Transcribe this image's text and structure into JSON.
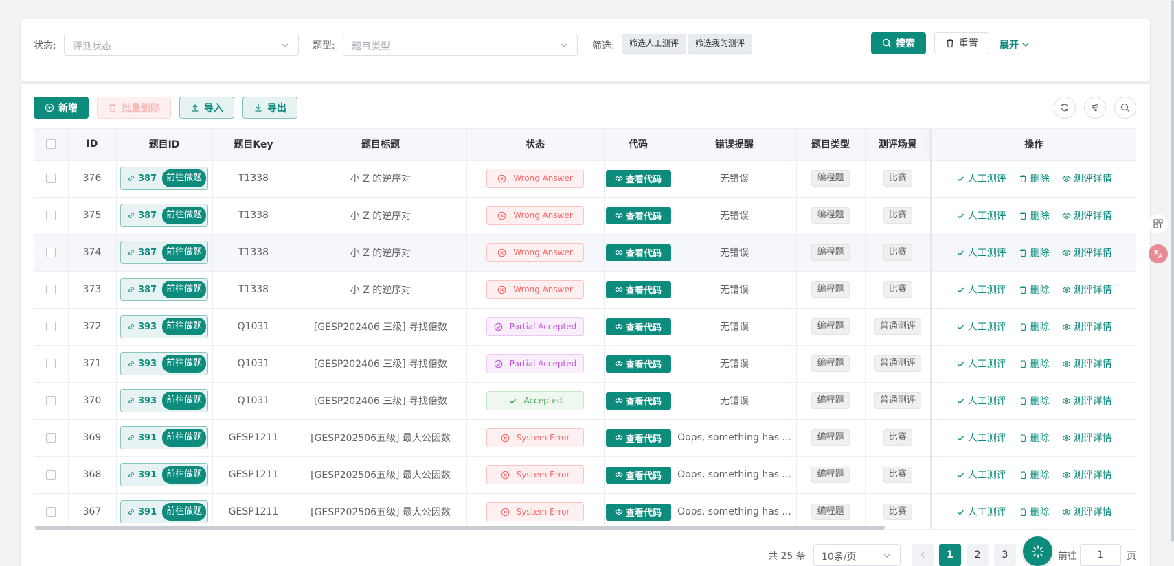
{
  "search": {
    "status_label": "状态:",
    "status_placeholder": "评测状态",
    "type_label": "题型:",
    "type_placeholder": "题目类型",
    "filter_label": "筛选:",
    "filter_manual": "筛选人工测评",
    "filter_mine": "筛选我的测评",
    "search_btn": "搜索",
    "reset_btn": "重置",
    "expand_link": "展开"
  },
  "toolbar": {
    "add": "新增",
    "batch_delete": "批量删除",
    "import": "导入",
    "export": "导出"
  },
  "table": {
    "headers": {
      "id": "ID",
      "problem_id": "题目ID",
      "problem_key": "题目Key",
      "title": "题目标题",
      "status": "状态",
      "code": "代码",
      "error": "错误提醒",
      "ptype": "题目类型",
      "scene": "测评场景",
      "ops": "操作"
    },
    "go_label": "前往做题",
    "code_label": "查看代码",
    "op_manual": "人工测评",
    "op_delete": "删除",
    "op_detail": "测评详情",
    "rows": [
      {
        "id": "376",
        "pid": "387",
        "key": "T1338",
        "title": "小 Z 的逆序对",
        "status": "Wrong Answer",
        "kind": "wa",
        "error": "无错误",
        "ptype": "编程题",
        "scene": "比赛"
      },
      {
        "id": "375",
        "pid": "387",
        "key": "T1338",
        "title": "小 Z 的逆序对",
        "status": "Wrong Answer",
        "kind": "wa",
        "error": "无错误",
        "ptype": "编程题",
        "scene": "比赛"
      },
      {
        "id": "374",
        "pid": "387",
        "key": "T1338",
        "title": "小 Z 的逆序对",
        "status": "Wrong Answer",
        "kind": "wa",
        "error": "无错误",
        "ptype": "编程题",
        "scene": "比赛"
      },
      {
        "id": "373",
        "pid": "387",
        "key": "T1338",
        "title": "小 Z 的逆序对",
        "status": "Wrong Answer",
        "kind": "wa",
        "error": "无错误",
        "ptype": "编程题",
        "scene": "比赛"
      },
      {
        "id": "372",
        "pid": "393",
        "key": "Q1031",
        "title": "[GESP202406 三级] 寻找倍数",
        "status": "Partial Accepted",
        "kind": "pa",
        "error": "无错误",
        "ptype": "编程题",
        "scene": "普通测评"
      },
      {
        "id": "371",
        "pid": "393",
        "key": "Q1031",
        "title": "[GESP202406 三级] 寻找倍数",
        "status": "Partial Accepted",
        "kind": "pa",
        "error": "无错误",
        "ptype": "编程题",
        "scene": "普通测评"
      },
      {
        "id": "370",
        "pid": "393",
        "key": "Q1031",
        "title": "[GESP202406 三级] 寻找倍数",
        "status": "Accepted",
        "kind": "ac",
        "error": "无错误",
        "ptype": "编程题",
        "scene": "普通测评"
      },
      {
        "id": "369",
        "pid": "391",
        "key": "GESP1211",
        "title": "[GESP202506五级] 最大公因数",
        "status": "System Error",
        "kind": "wa",
        "error": "Oops, something has ...",
        "ptype": "编程题",
        "scene": "比赛"
      },
      {
        "id": "368",
        "pid": "391",
        "key": "GESP1211",
        "title": "[GESP202506五级] 最大公因数",
        "status": "System Error",
        "kind": "wa",
        "error": "Oops, something has ...",
        "ptype": "编程题",
        "scene": "比赛"
      },
      {
        "id": "367",
        "pid": "391",
        "key": "GESP1211",
        "title": "[GESP202506五级] 最大公因数",
        "status": "System Error",
        "kind": "wa",
        "error": "Oops, something has ...",
        "ptype": "编程题",
        "scene": "比赛"
      }
    ]
  },
  "pagination": {
    "total": "共 25 条",
    "page_size": "10条/页",
    "pages": [
      "1",
      "2",
      "3"
    ],
    "current": "1",
    "jump_prefix": "前往",
    "jump_value": "1",
    "jump_suffix": "页"
  },
  "colors": {
    "primary": "#0d8c7e",
    "danger": "#f56c6c",
    "partial": "#c259d9",
    "success": "#3aa84c"
  }
}
